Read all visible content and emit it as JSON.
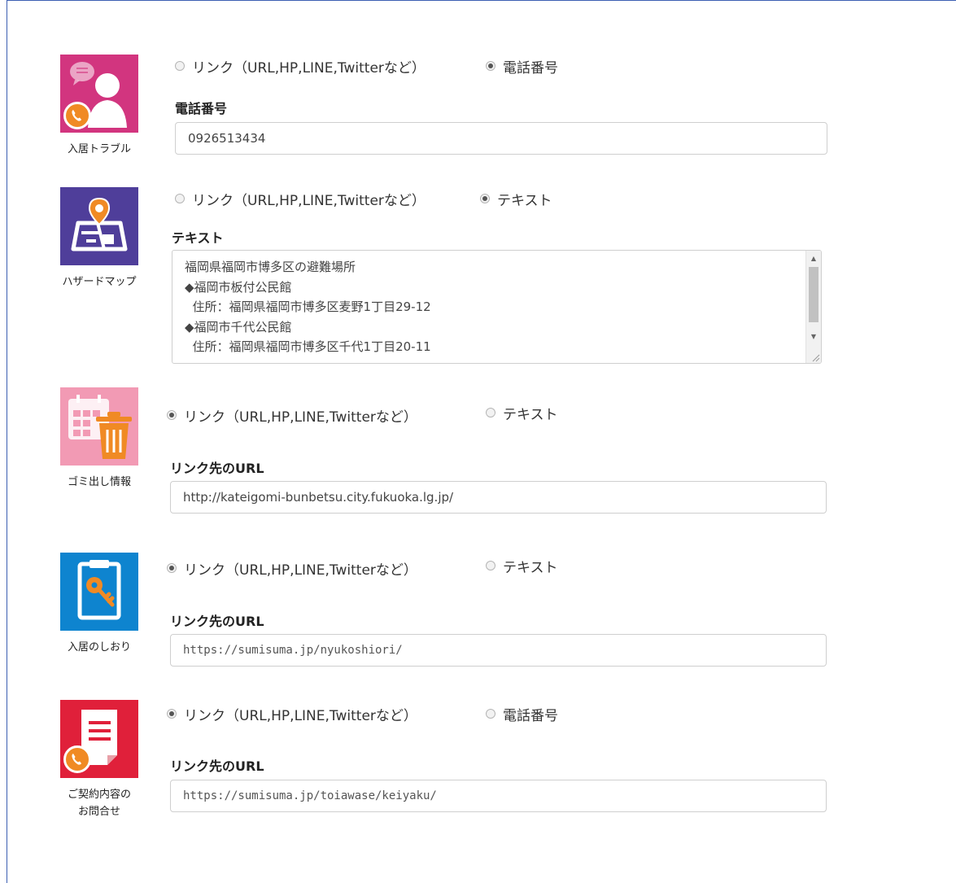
{
  "items": [
    {
      "label": "入居トラブル",
      "color": "#d2357f",
      "icon": "resident-support-icon",
      "option_link": "リンク（URL,HP,LINE,Twitterなど）",
      "option_alt": "電話番号",
      "selected": "alt",
      "field_label": "電話番号",
      "field_value": "0926513434"
    },
    {
      "label": "ハザードマップ",
      "color": "#4f3e9a",
      "icon": "map-pin-icon",
      "option_link": "リンク（URL,HP,LINE,Twitterなど）",
      "option_alt": "テキスト",
      "selected": "alt",
      "field_label": "テキスト",
      "textarea_lines": [
        "福岡県福岡市博多区の避難場所",
        "◆福岡市板付公民館",
        "  住所：福岡県福岡市博多区麦野1丁目29-12",
        "◆福岡市千代公民館",
        "  住所：福岡県福岡市博多区千代1丁目20-11"
      ]
    },
    {
      "label": "ゴミ出し情報",
      "color": "#f29ab4",
      "icon": "trash-calendar-icon",
      "option_link": "リンク（URL,HP,LINE,Twitterなど）",
      "option_alt": "テキスト",
      "selected": "link",
      "field_label": "リンク先のURL",
      "field_value": "http://kateigomi-bunbetsu.city.fukuoka.lg.jp/"
    },
    {
      "label": "入居のしおり",
      "color": "#0e84cf",
      "icon": "key-clipboard-icon",
      "option_link": "リンク（URL,HP,LINE,Twitterなど）",
      "option_alt": "テキスト",
      "selected": "link",
      "field_label": "リンク先のURL",
      "field_value": "https://sumisuma.jp/nyukoshiori/"
    },
    {
      "label": "ご契約内容の\nお問合せ",
      "label_lines": [
        "ご契約内容の",
        "お問合せ"
      ],
      "color": "#e0203a",
      "icon": "contract-document-icon",
      "option_link": "リンク（URL,HP,LINE,Twitterなど）",
      "option_alt": "電話番号",
      "selected": "link",
      "field_label": "リンク先のURL",
      "field_value": "https://sumisuma.jp/toiawase/keiyaku/"
    }
  ],
  "textarea_scroll": {
    "up": "▲",
    "down": "▼"
  }
}
